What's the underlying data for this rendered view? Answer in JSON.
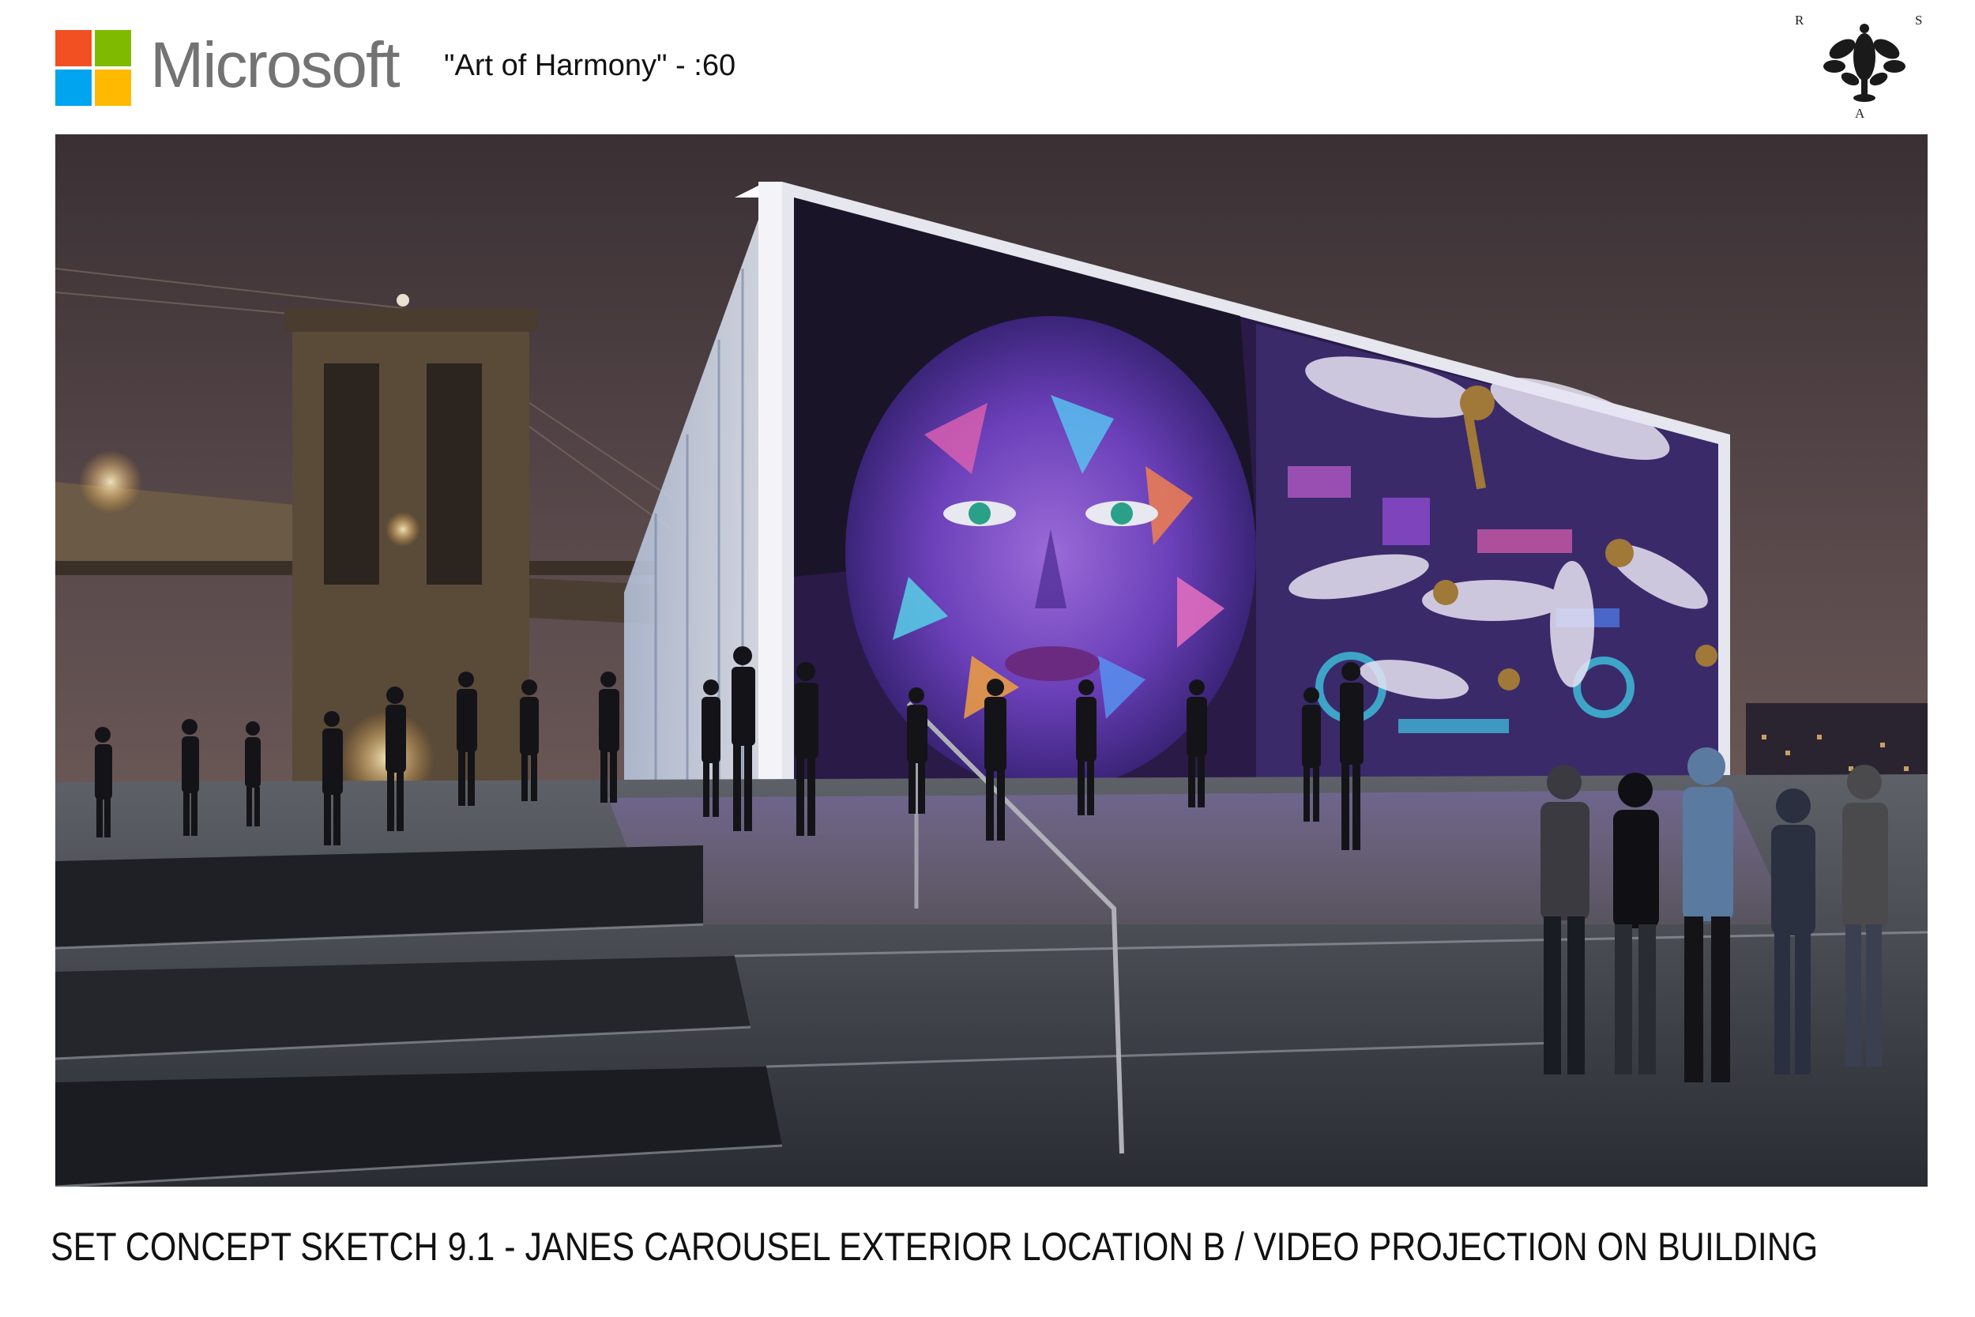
{
  "header": {
    "brand": "Microsoft",
    "spot_title": "\"Art of Harmony\" - :60",
    "logo_colors": [
      "#f25022",
      "#7fba00",
      "#00a4ef",
      "#ffb900"
    ],
    "monogram": {
      "letters": [
        "R",
        "S",
        "A"
      ]
    }
  },
  "scene": {
    "description_icon": "rendering-image"
  },
  "caption": "SET CONCEPT SKETCH  9.1 -  JANES CAROUSEL EXTERIOR LOCATION B /  VIDEO PROJECTION ON BUILDING"
}
